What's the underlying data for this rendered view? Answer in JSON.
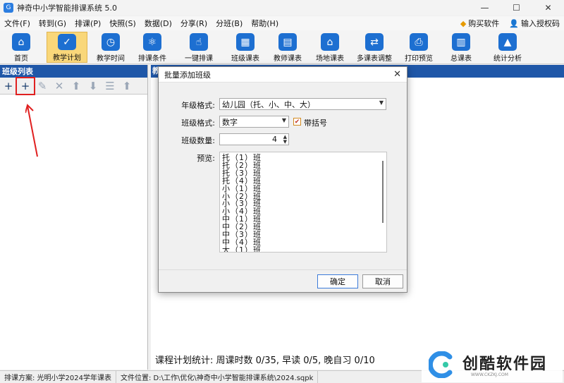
{
  "window": {
    "title": "神奇中小学智能排课系统 5.0",
    "app_icon_glyph": "G",
    "controls": [
      "—",
      "☐",
      "✕"
    ]
  },
  "menu": [
    {
      "label": "文件(F)"
    },
    {
      "label": "转到(G)"
    },
    {
      "label": "排课(P)"
    },
    {
      "label": "快照(S)"
    },
    {
      "label": "数据(D)"
    },
    {
      "label": "分享(R)"
    },
    {
      "label": "分班(B)"
    },
    {
      "label": "帮助(H)"
    }
  ],
  "links": {
    "buy": "购买软件",
    "license": "输入授权码"
  },
  "toolbar": [
    {
      "label": "首页",
      "glyph": "⌂"
    },
    {
      "label": "教学计划",
      "glyph": "✓"
    },
    {
      "label": "教学时间",
      "glyph": "◷"
    },
    {
      "label": "排课条件",
      "glyph": "⚛"
    },
    {
      "label": "一键排课",
      "glyph": "☝"
    },
    {
      "label": "班级课表",
      "glyph": "▦"
    },
    {
      "label": "教师课表",
      "glyph": "▤"
    },
    {
      "label": "场地课表",
      "glyph": "⌂"
    },
    {
      "label": "多课表调整",
      "glyph": "⇄"
    },
    {
      "label": "打印预览",
      "glyph": "⎙"
    },
    {
      "label": "总课表",
      "glyph": "▥"
    },
    {
      "label": "统计分析",
      "glyph": "▲"
    }
  ],
  "left_panel": {
    "title": "班级列表",
    "tools": [
      "+",
      "+",
      "✎",
      "✕",
      "⬆",
      "⬇",
      "☰",
      "⬆"
    ]
  },
  "work": {
    "header_text": "教",
    "stats": "课程计划统计: 周课时数 0/35, 早读 0/5, 晚自习 0/10"
  },
  "status": {
    "plan": "排课方案: 光明小学2024学年课表",
    "file": "文件位置: D:\\工作\\优化\\神奇中小学智能排课系统\\2024.sqpk"
  },
  "dialog": {
    "title": "批量添加班级",
    "close": "✕",
    "grade_label": "年级格式:",
    "grade_value": "幼儿园（托、小、中、大）",
    "class_label": "班级格式:",
    "class_value": "数字",
    "bracket_label": "带括号",
    "count_label": "班级数量:",
    "count_value": "4",
    "preview_label": "预览:",
    "preview_lines": [
      "托（1）班",
      "托（2）班",
      "托（3）班",
      "托（4）班",
      "小（1）班",
      "小（2）班",
      "小（3）班",
      "小（4）班",
      "中（1）班",
      "中（2）班",
      "中（3）班",
      "中（4）班",
      "大（1）班"
    ],
    "ok": "确定",
    "cancel": "取消"
  },
  "watermark": {
    "text": "创酷软件园",
    "url": "WWW.CKZKJ.COM"
  }
}
